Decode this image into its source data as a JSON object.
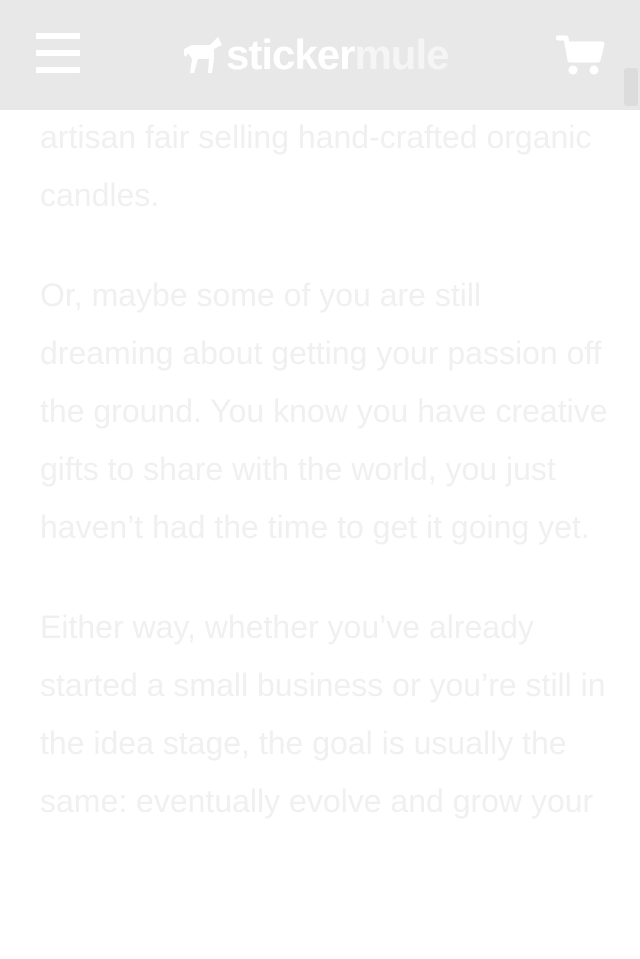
{
  "header": {
    "menu_icon": "hamburger-menu-icon",
    "logo_part1": "sticker",
    "logo_part2": "mule",
    "logo_icon": "mule-logo-icon",
    "cart_icon": "shopping-cart-icon",
    "background": "#e8e8e8"
  },
  "article": {
    "paragraphs": [
      "artisan fair selling hand-crafted organic candles.",
      "Or, maybe some of you are still dreaming about getting your passion off the ground. You know you have creative gifts to share with the world, you just haven’t had the time to get it going yet.",
      "Either way, whether you’ve already started a small business or you’re still in the idea stage, the goal is usually the same: eventually evolve and grow your"
    ],
    "text_color": "#f0f0f0"
  }
}
